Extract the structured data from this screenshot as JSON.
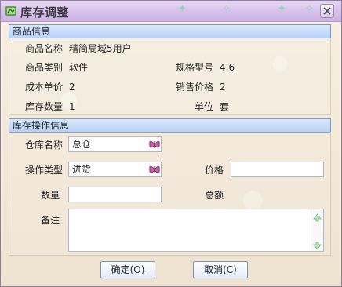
{
  "window": {
    "title": "库存调整"
  },
  "product_info": {
    "header": "商品信息",
    "name_label": "商品名称",
    "name_value": "精简局域5用户",
    "category_label": "商品类别",
    "category_value": "软件",
    "spec_label": "规格型号",
    "spec_value": "4.6",
    "cost_label": "成本单价",
    "cost_value": "2",
    "sale_price_label": "销售价格",
    "sale_price_value": "2",
    "stock_qty_label": "库存数量",
    "stock_qty_value": "1",
    "unit_label": "单位",
    "unit_value": "套"
  },
  "inventory_operation": {
    "header": "库存操作信息",
    "warehouse_label": "仓库名称",
    "warehouse_value": "总仓",
    "operation_type_label": "操作类型",
    "operation_type_value": "进货",
    "price_label": "价格",
    "price_value": "",
    "quantity_label": "数量",
    "quantity_value": "",
    "total_label": "总额",
    "notes_label": "备注",
    "notes_value": ""
  },
  "buttons": {
    "confirm": "确定(O)",
    "cancel": "取消(C)"
  },
  "icons": {
    "title": "app-icon",
    "dropdown": "butterfly-dropdown-icon",
    "close": "close-icon",
    "scroll_up": "scroll-up-icon",
    "scroll_down": "scroll-down-icon"
  }
}
